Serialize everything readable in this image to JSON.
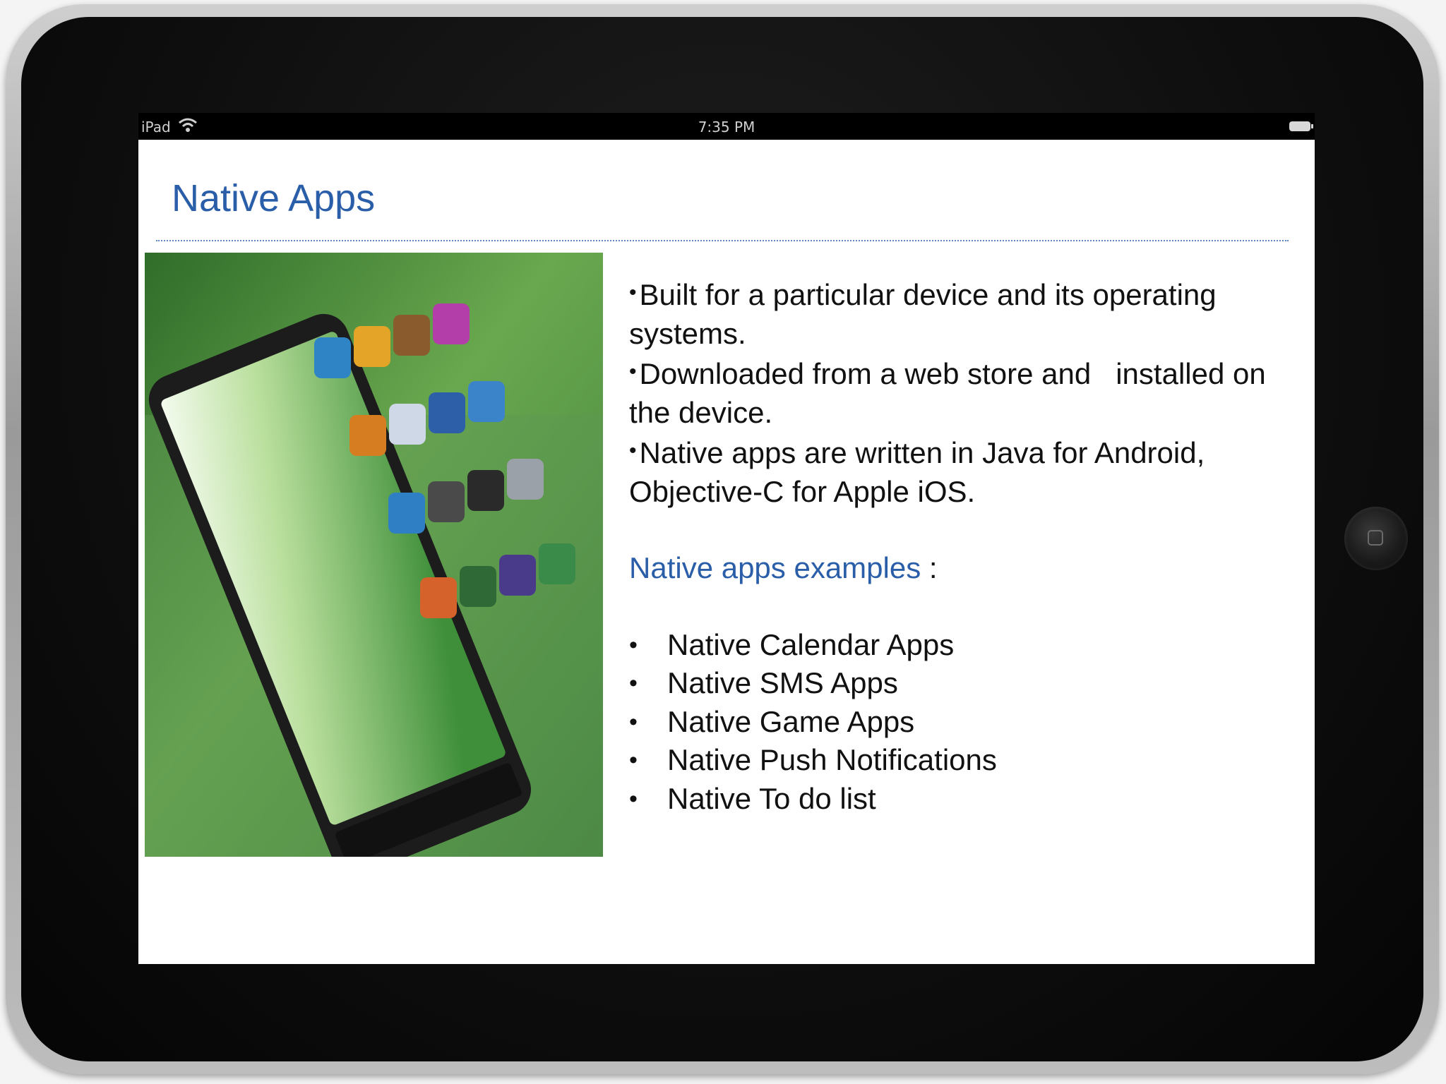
{
  "status_bar": {
    "device_name": "iPad",
    "time": "7:35 PM"
  },
  "slide": {
    "title": "Native Apps",
    "paragraphs": [
      "Built for a particular device and its operating systems.",
      "Downloaded from a web store and   installed on the device.",
      "Native apps are written in Java for Android, Objective-C for Apple iOS."
    ],
    "bullet_symbol": "•",
    "examples_heading": "Native apps examples",
    "examples_heading_suffix": " :",
    "examples": [
      "Native Calendar Apps",
      "Native SMS Apps",
      "Native Game Apps",
      "Native Push Notifications",
      "Native To do list"
    ]
  },
  "colors": {
    "title_blue": "#2a5ea8",
    "body_text": "#111111",
    "bezel": "#0e0e0e",
    "screen_bg": "#ffffff",
    "image_green": "#4f9a3c"
  },
  "icons": {
    "wifi": "wifi-icon",
    "battery": "battery-icon",
    "home": "home-button-icon",
    "illustration": "smartphone-with-app-icons-illustration"
  }
}
